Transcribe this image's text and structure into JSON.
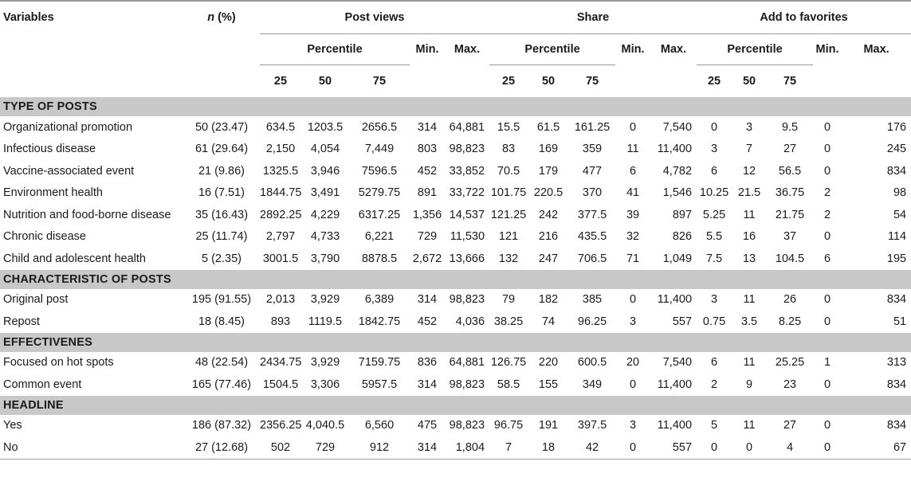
{
  "headers": {
    "variables": "Variables",
    "n_pct_italic": "n",
    "n_pct_rest": " (%)",
    "groups": [
      "Post views",
      "Share",
      "Add to favorites"
    ],
    "percentile": "Percentile",
    "min": "Min.",
    "max": "Max.",
    "p25": "25",
    "p50": "50",
    "p75": "75"
  },
  "sections": [
    {
      "title": "TYPE OF POSTS",
      "rows": [
        [
          "Organizational promotion",
          "50 (23.47)",
          "634.5",
          "1203.5",
          "2656.5",
          "314",
          "64,881",
          "15.5",
          "61.5",
          "161.25",
          "0",
          "7,540",
          "0",
          "3",
          "9.5",
          "0",
          "176"
        ],
        [
          "Infectious disease",
          "61 (29.64)",
          "2,150",
          "4,054",
          "7,449",
          "803",
          "98,823",
          "83",
          "169",
          "359",
          "11",
          "11,400",
          "3",
          "7",
          "27",
          "0",
          "245"
        ],
        [
          "Vaccine-associated event",
          "21 (9.86)",
          "1325.5",
          "3,946",
          "7596.5",
          "452",
          "33,852",
          "70.5",
          "179",
          "477",
          "6",
          "4,782",
          "6",
          "12",
          "56.5",
          "0",
          "834"
        ],
        [
          "Environment health",
          "16 (7.51)",
          "1844.75",
          "3,491",
          "5279.75",
          "891",
          "33,722",
          "101.75",
          "220.5",
          "370",
          "41",
          "1,546",
          "10.25",
          "21.5",
          "36.75",
          "2",
          "98"
        ],
        [
          "Nutrition and food-borne disease",
          "35 (16.43)",
          "2892.25",
          "4,229",
          "6317.25",
          "1,356",
          "14,537",
          "121.25",
          "242",
          "377.5",
          "39",
          "897",
          "5.25",
          "11",
          "21.75",
          "2",
          "54"
        ],
        [
          "Chronic disease",
          "25 (11.74)",
          "2,797",
          "4,733",
          "6,221",
          "729",
          "11,530",
          "121",
          "216",
          "435.5",
          "32",
          "826",
          "5.5",
          "16",
          "37",
          "0",
          "114"
        ],
        [
          "Child and adolescent health",
          "5 (2.35)",
          "3001.5",
          "3,790",
          "8878.5",
          "2,672",
          "13,666",
          "132",
          "247",
          "706.5",
          "71",
          "1,049",
          "7.5",
          "13",
          "104.5",
          "6",
          "195"
        ]
      ]
    },
    {
      "title": "CHARACTERISTIC OF POSTS",
      "rows": [
        [
          "Original post",
          "195 (91.55)",
          "2,013",
          "3,929",
          "6,389",
          "314",
          "98,823",
          "79",
          "182",
          "385",
          "0",
          "11,400",
          "3",
          "11",
          "26",
          "0",
          "834"
        ],
        [
          "Repost",
          "18 (8.45)",
          "893",
          "1119.5",
          "1842.75",
          "452",
          "4,036",
          "38.25",
          "74",
          "96.25",
          "3",
          "557",
          "0.75",
          "3.5",
          "8.25",
          "0",
          "51"
        ]
      ]
    },
    {
      "title": "EFFECTIVENES",
      "rows": [
        [
          "Focused on hot spots",
          "48 (22.54)",
          "2434.75",
          "3,929",
          "7159.75",
          "836",
          "64,881",
          "126.75",
          "220",
          "600.5",
          "20",
          "7,540",
          "6",
          "11",
          "25.25",
          "1",
          "313"
        ],
        [
          "Common event",
          "165 (77.46)",
          "1504.5",
          "3,306",
          "5957.5",
          "314",
          "98,823",
          "58.5",
          "155",
          "349",
          "0",
          "11,400",
          "2",
          "9",
          "23",
          "0",
          "834"
        ]
      ]
    },
    {
      "title": "HEADLINE",
      "rows": [
        [
          "Yes",
          "186 (87.32)",
          "2356.25",
          "4,040.5",
          "6,560",
          "475",
          "98,823",
          "96.75",
          "191",
          "397.5",
          "3",
          "11,400",
          "5",
          "11",
          "27",
          "0",
          "834"
        ],
        [
          "No",
          "27 (12.68)",
          "502",
          "729",
          "912",
          "314",
          "1,804",
          "7",
          "18",
          "42",
          "0",
          "557",
          "0",
          "0",
          "4",
          "0",
          "67"
        ]
      ]
    }
  ]
}
